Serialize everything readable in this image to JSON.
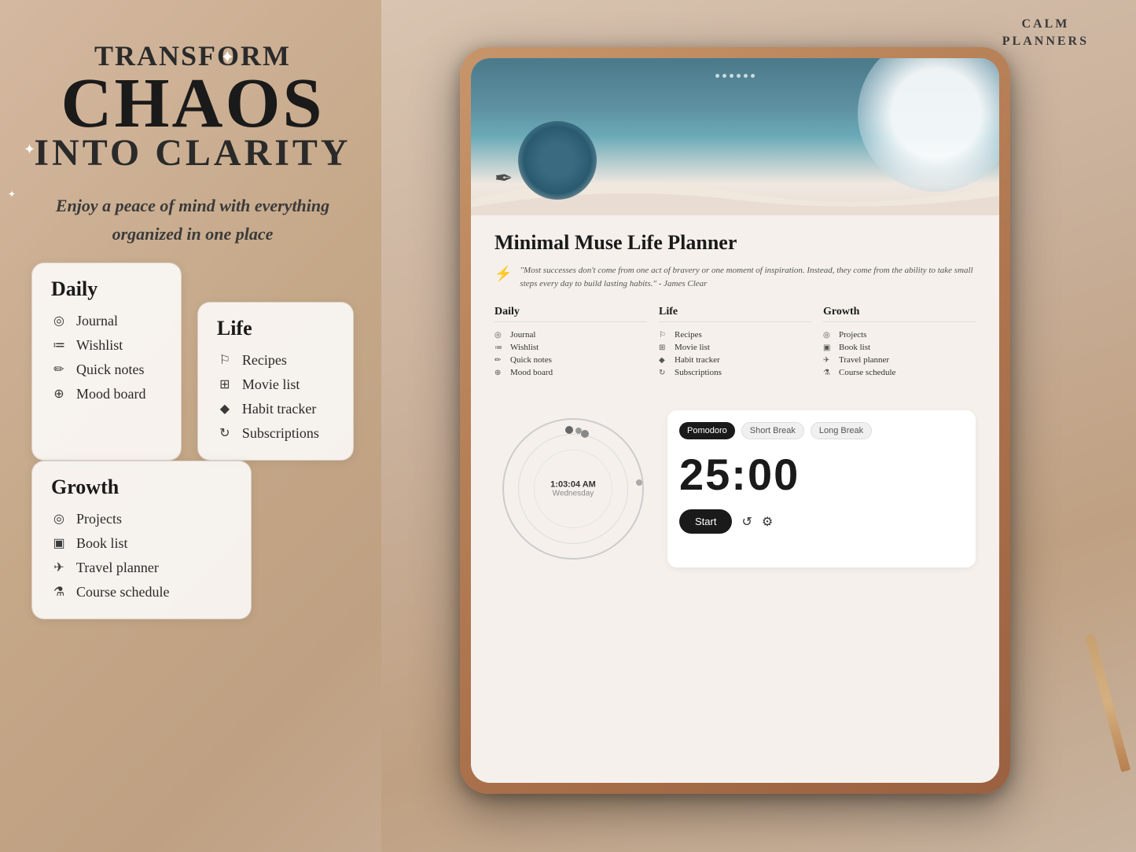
{
  "brand": {
    "name_line1": "CALM",
    "name_line2": "PLANNERS"
  },
  "headline": {
    "transform": "TRANSFORM",
    "chaos": "CHAOS",
    "clarity": "INTO CLARITY",
    "tagline_line1": "Enjoy a peace of mind with everything",
    "tagline_line2": "organized in one place"
  },
  "daily_card": {
    "title": "Daily",
    "items": [
      {
        "icon": "◎",
        "label": "Journal"
      },
      {
        "icon": "≔",
        "label": "Wishlist"
      },
      {
        "icon": "✏",
        "label": "Quick notes"
      },
      {
        "icon": "⊕",
        "label": "Mood board"
      }
    ]
  },
  "life_card": {
    "title": "Life",
    "items": [
      {
        "icon": "⚐",
        "label": "Recipes"
      },
      {
        "icon": "⊞",
        "label": "Movie list"
      },
      {
        "icon": "◆",
        "label": "Habit tracker"
      },
      {
        "icon": "↻",
        "label": "Subscriptions"
      }
    ]
  },
  "growth_card": {
    "title": "Growth",
    "items": [
      {
        "icon": "◎",
        "label": "Projects"
      },
      {
        "icon": "▣",
        "label": "Book list"
      },
      {
        "icon": "✈",
        "label": "Travel planner"
      },
      {
        "icon": "⚗",
        "label": "Course schedule"
      }
    ]
  },
  "tablet": {
    "planner_title": "Minimal Muse Life Planner",
    "quote": "\"Most successes don't come from one act of bravery or one moment of inspiration. Instead, they come from the ability to take small steps every day to build lasting habits.\" - James Clear",
    "nav": {
      "daily": {
        "title": "Daily",
        "items": [
          "Journal",
          "Wishlist",
          "Quick notes",
          "Mood board"
        ],
        "icons": [
          "◎",
          "≔",
          "✏",
          "⊕"
        ]
      },
      "life": {
        "title": "Life",
        "items": [
          "Recipes",
          "Movie list",
          "Habit tracker",
          "Subscriptions"
        ],
        "icons": [
          "⚐",
          "⊞",
          "◆",
          "↻"
        ]
      },
      "growth": {
        "title": "Growth",
        "items": [
          "Projects",
          "Book list",
          "Travel planner",
          "Course schedule"
        ],
        "icons": [
          "◎",
          "▣",
          "✈",
          "⚗"
        ]
      }
    },
    "clock_time": "1:03:04 AM",
    "clock_day": "Wednesday",
    "timer": {
      "display": "25:00",
      "tabs": [
        "Pomodoro",
        "Short Break",
        "Long Break"
      ],
      "active_tab": 0,
      "start_label": "Start"
    }
  }
}
